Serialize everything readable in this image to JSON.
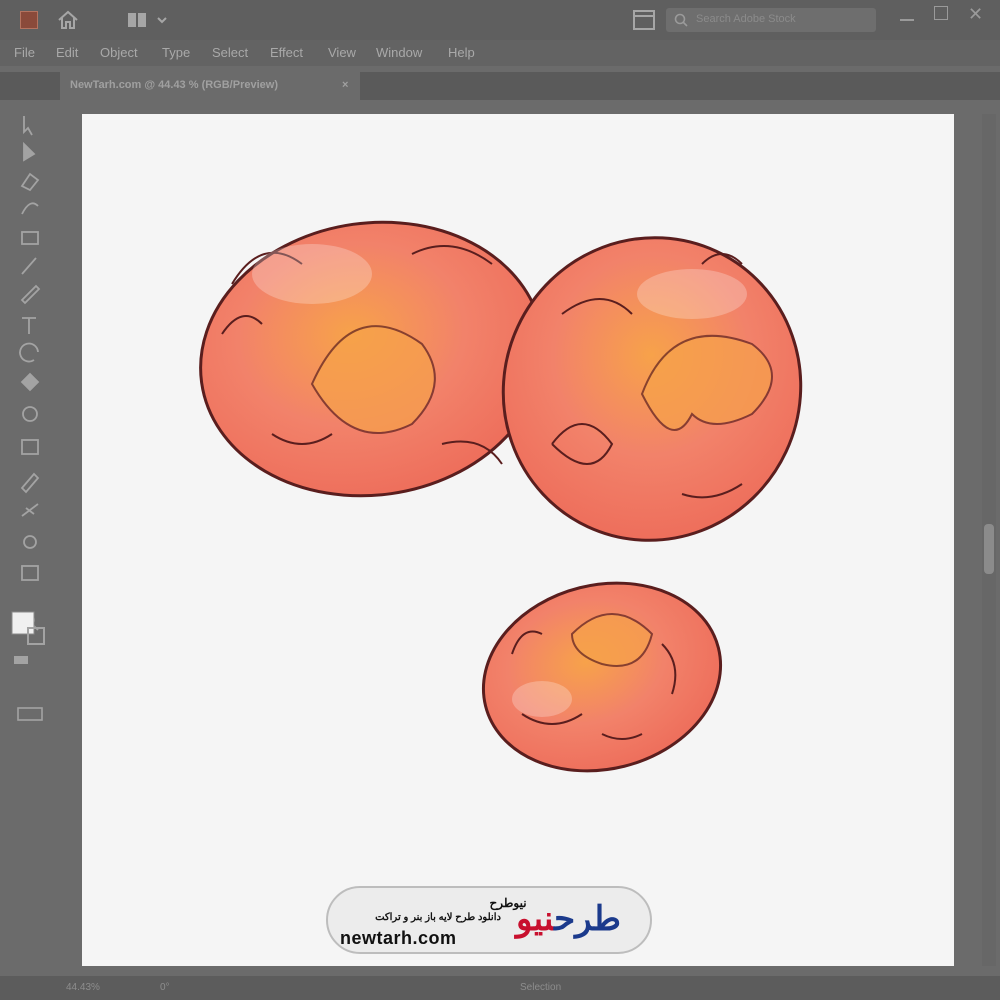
{
  "menu": [
    "File",
    "Edit",
    "Object",
    "Type",
    "Select",
    "Effect",
    "View",
    "Window",
    "Help"
  ],
  "search": {
    "placeholder": "Search Adobe Stock"
  },
  "document": {
    "tab_title": "NewTarh.com @ 44.43 % (RGB/Preview)",
    "close": "×"
  },
  "tools": [
    "selection-tool",
    "direct-selection-tool",
    "pen-tool",
    "curvature-tool",
    "rectangle-tool",
    "paintbrush-tool",
    "pencil-tool",
    "type-tool",
    "rotate-tool",
    "scale-tool",
    "eraser-tool",
    "shape-builder-tool",
    "gradient-tool",
    "eyedropper-tool",
    "blend-tool",
    "symbol-sprayer-tool",
    "artboard-tool",
    "hand-tool",
    "zoom-tool"
  ],
  "status": {
    "zoom": "44.43%",
    "angle": "0°",
    "mode": "Selection"
  },
  "logo": {
    "name": "نیوطرح",
    "tagline": "دانلود طرح لایه باز بنر و تراکت",
    "url": "newtarh.com",
    "mark_a": "نیو",
    "mark_b": "طرح"
  },
  "colors": {
    "egg_fill": "#f2826a",
    "egg_accent": "#f7a24a",
    "egg_outline": "#5a1e1e",
    "canvas": "#f5f5f5",
    "ui_dark": "#5f5f5f"
  }
}
